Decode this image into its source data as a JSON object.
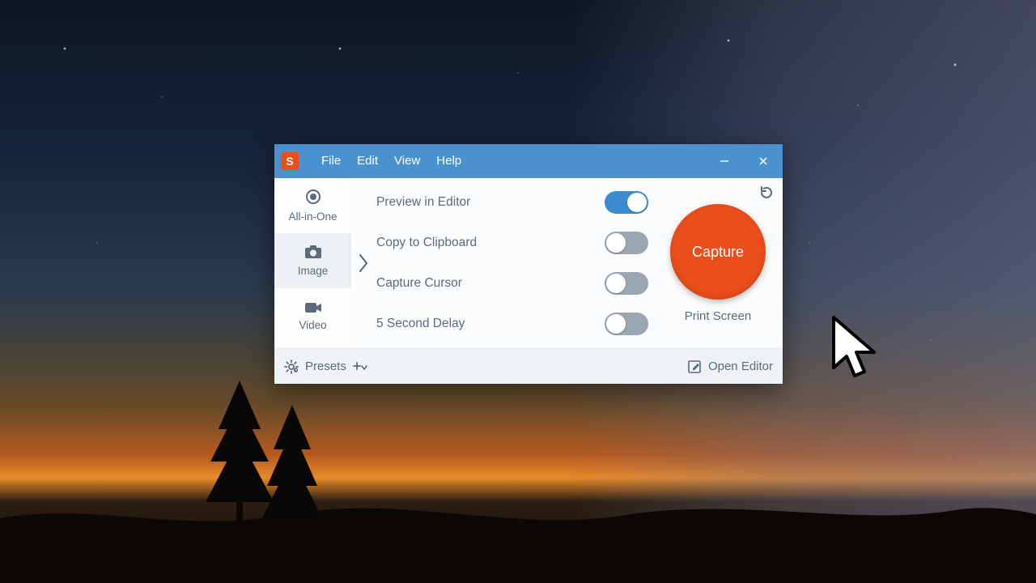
{
  "menu": {
    "file": "File",
    "edit": "Edit",
    "view": "View",
    "help": "Help"
  },
  "tabs": {
    "allinone": "All-in-One",
    "image": "Image",
    "video": "Video",
    "selected": "image"
  },
  "options": {
    "preview": {
      "label": "Preview in Editor",
      "on": true
    },
    "clipboard": {
      "label": "Copy to Clipboard",
      "on": false
    },
    "cursor": {
      "label": "Capture Cursor",
      "on": false
    },
    "delay": {
      "label": "5 Second Delay",
      "on": false
    }
  },
  "capture": {
    "button": "Capture",
    "shortcut": "Print Screen"
  },
  "footer": {
    "presets": "Presets",
    "open_editor": "Open Editor"
  },
  "colors": {
    "accent": "#4a91cf",
    "action": "#e94e1b"
  }
}
